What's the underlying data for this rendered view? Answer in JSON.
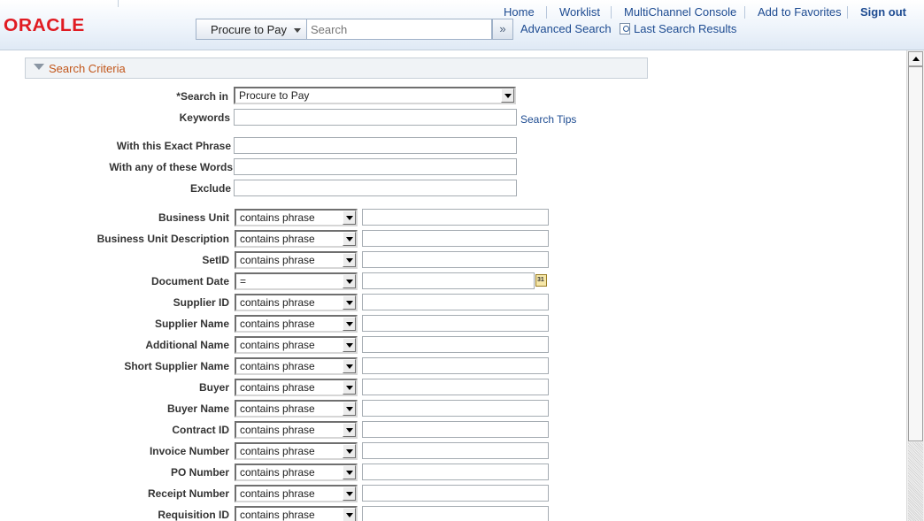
{
  "brand": {
    "logo_text": "ORACLE",
    "logo_color": "#e01b22",
    "link_color": "#1d4b91"
  },
  "nav": {
    "home": "Home",
    "worklist": "Worklist",
    "multichannel": "MultiChannel Console",
    "favorites": "Add to Favorites",
    "signout": "Sign out"
  },
  "search": {
    "scope": "Procure to Pay",
    "placeholder": "Search",
    "go_icon": "double-chevron-right-icon",
    "advanced": "Advanced Search",
    "last_results": "Last Search Results"
  },
  "criteria": {
    "title": "Search Criteria",
    "search_in_label": "*Search in",
    "search_in_value": "Procure to Pay",
    "keywords_label": "Keywords",
    "keywords_value": "",
    "search_tips": "Search Tips",
    "exact_phrase_label": "With this Exact Phrase",
    "any_words_label": "With any of these Words",
    "exclude_label": "Exclude",
    "fields": [
      {
        "label": "Business Unit",
        "operator": "contains phrase",
        "value": ""
      },
      {
        "label": "Business Unit Description",
        "operator": "contains phrase",
        "value": ""
      },
      {
        "label": "SetID",
        "operator": "contains phrase",
        "value": ""
      },
      {
        "label": "Document Date",
        "operator": "=",
        "value": ""
      },
      {
        "label": "Supplier ID",
        "operator": "contains phrase",
        "value": ""
      },
      {
        "label": "Supplier Name",
        "operator": "contains phrase",
        "value": ""
      },
      {
        "label": "Additional Name",
        "operator": "contains phrase",
        "value": ""
      },
      {
        "label": "Short Supplier Name",
        "operator": "contains phrase",
        "value": ""
      },
      {
        "label": "Buyer",
        "operator": "contains phrase",
        "value": ""
      },
      {
        "label": "Buyer Name",
        "operator": "contains phrase",
        "value": ""
      },
      {
        "label": "Contract ID",
        "operator": "contains phrase",
        "value": ""
      },
      {
        "label": "Invoice Number",
        "operator": "contains phrase",
        "value": ""
      },
      {
        "label": "PO Number",
        "operator": "contains phrase",
        "value": ""
      },
      {
        "label": "Receipt Number",
        "operator": "contains phrase",
        "value": ""
      },
      {
        "label": "Requisition ID",
        "operator": "contains phrase",
        "value": ""
      }
    ],
    "calendar_icon": "calendar-icon",
    "calendar_glyph": "31"
  }
}
